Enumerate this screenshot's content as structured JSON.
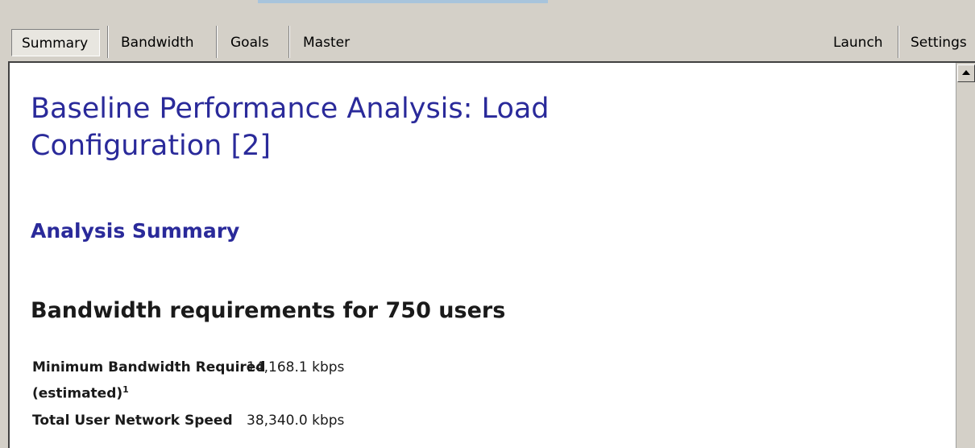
{
  "tabs": {
    "left": [
      "Summary",
      "Bandwidth",
      "Goals",
      "Master"
    ],
    "right": [
      "Launch",
      "Settings"
    ]
  },
  "document": {
    "title_line1": "Baseline Performance Analysis: Load",
    "title_line2": "Configuration [2]",
    "section_title": "Analysis Summary",
    "subsection_title": "Bandwidth requirements for 750 users",
    "rows": [
      {
        "label": "Minimum Bandwidth Required",
        "label_cont": "(estimated)",
        "footnote": "1",
        "value": "14,168.1 kbps"
      },
      {
        "label": "Total User Network Speed",
        "value": "38,340.0 kbps"
      }
    ]
  },
  "colors": {
    "heading_blue": "#2a2a9a",
    "chrome_gray": "#d4d0c8"
  }
}
